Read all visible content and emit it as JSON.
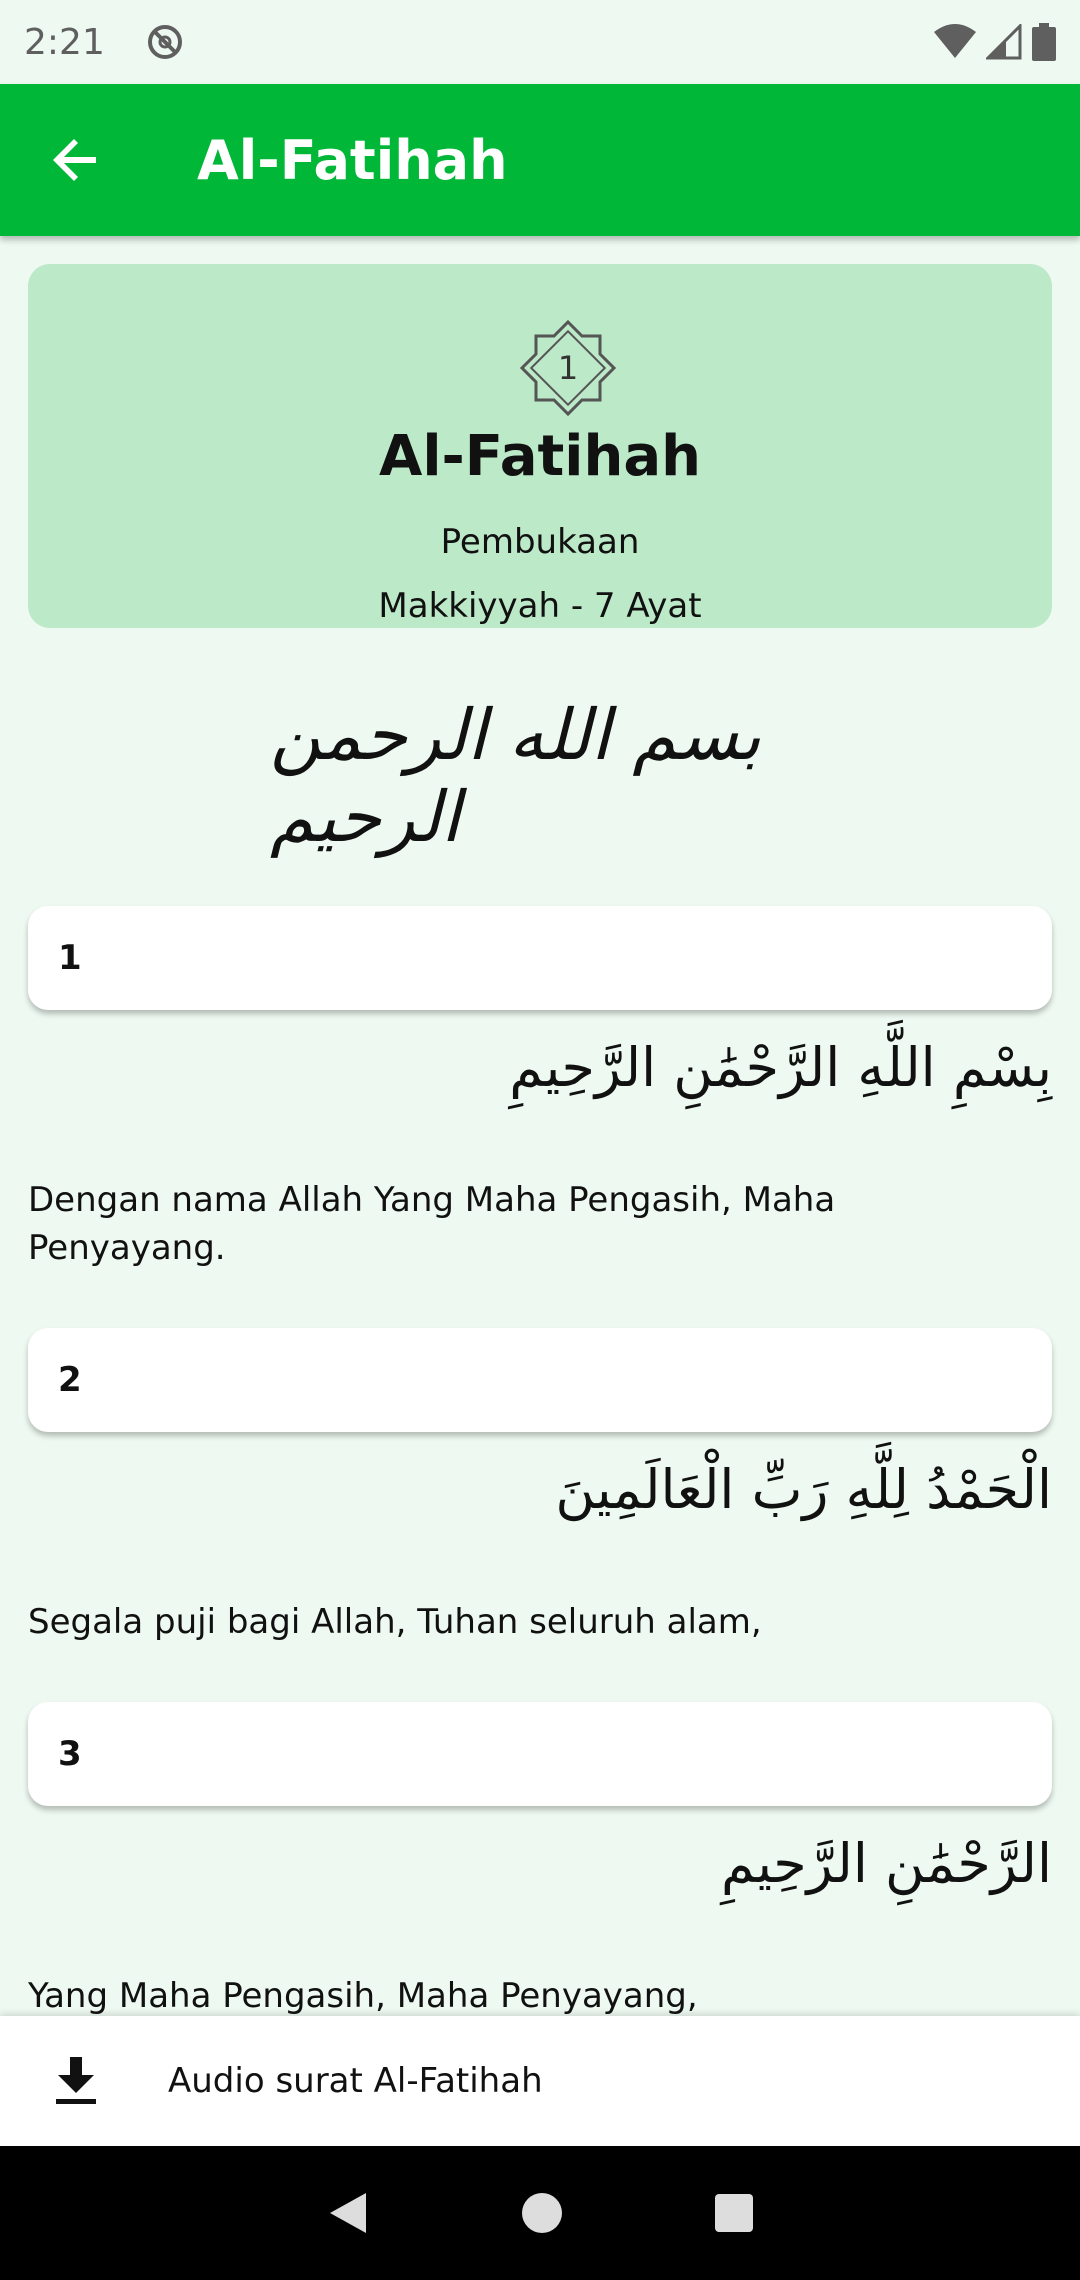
{
  "status_bar": {
    "time": "2:21"
  },
  "app_bar": {
    "title": "Al-Fatihah"
  },
  "surah": {
    "number": "1",
    "name": "Al-Fatihah",
    "meaning": "Pembukaan",
    "info": "Makkiyyah - 7 Ayat"
  },
  "bismillah": "بسم الله الرحمن الرحيم",
  "ayahs": [
    {
      "number": "1",
      "arabic": "بِسْمِ اللَّهِ الرَّحْمَٰنِ الرَّحِيمِ",
      "translation": "Dengan nama Allah Yang Maha Pengasih, Maha Penyayang."
    },
    {
      "number": "2",
      "arabic": "الْحَمْدُ لِلَّهِ رَبِّ الْعَالَمِينَ",
      "translation": "Segala puji bagi Allah, Tuhan seluruh alam,"
    },
    {
      "number": "3",
      "arabic": "الرَّحْمَٰنِ الرَّحِيمِ",
      "translation": "Yang Maha Pengasih, Maha Penyayang,"
    }
  ],
  "bottom_bar": {
    "label": "Audio surat Al-Fatihah",
    "icon": "download-icon"
  },
  "colors": {
    "primary": "#00b738",
    "header_card": "#bce9c8",
    "background": "#eefaf1"
  }
}
